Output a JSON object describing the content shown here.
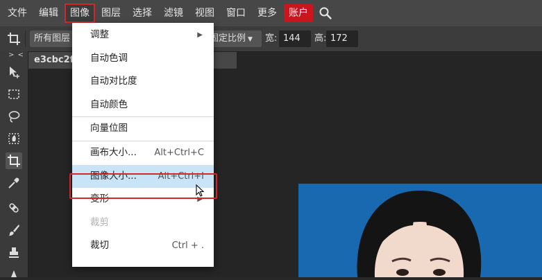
{
  "menubar": {
    "items": [
      "文件",
      "编辑",
      "图像",
      "图层",
      "选择",
      "滤镜",
      "视图",
      "窗口",
      "更多"
    ],
    "account_label": "账户",
    "active_index": 2
  },
  "options_bar": {
    "layer_select": "所有图层",
    "ratio_select": "固定比例",
    "width_label": "宽:",
    "width_value": "144",
    "height_label": "高:",
    "height_value": "172"
  },
  "toolbar": {
    "collapse_label": "> <"
  },
  "document": {
    "tab_title": "e3cbc2f8"
  },
  "image_menu": {
    "group1": [
      {
        "label": "调整",
        "submenu": true
      },
      {
        "label": "自动色调"
      },
      {
        "label": "自动对比度"
      },
      {
        "label": "自动颜色"
      }
    ],
    "group2": [
      {
        "label": "向量位图"
      }
    ],
    "group3": [
      {
        "label": "画布大小...",
        "shortcut": "Alt+Ctrl+C"
      },
      {
        "label": "图像大小...",
        "shortcut": "Alt+Ctrl+I",
        "highlighted": true
      },
      {
        "label": "变形",
        "submenu": true
      },
      {
        "label": "裁剪",
        "disabled": true
      },
      {
        "label": "裁切",
        "shortcut": "Ctrl + ."
      }
    ]
  },
  "colors": {
    "accent_red": "#d0262c",
    "photo_background": "#1969b0",
    "menu_highlight": "#c9e3f7"
  }
}
